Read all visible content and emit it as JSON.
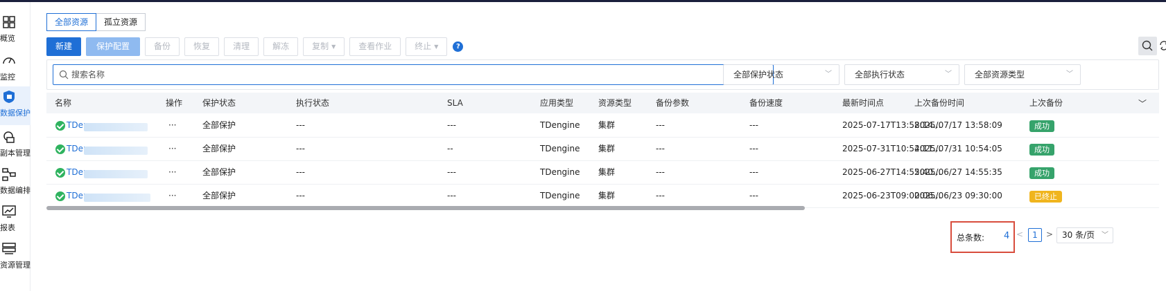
{
  "nav": {
    "items": [
      {
        "label": "概览",
        "icon": "grid-icon"
      },
      {
        "label": "监控",
        "icon": "gauge-icon"
      },
      {
        "label": "数据保护",
        "icon": "shield-icon",
        "active": true
      },
      {
        "label": "副本管理",
        "icon": "copy-icon"
      },
      {
        "label": "数据编排",
        "icon": "flow-icon"
      },
      {
        "label": "报表",
        "icon": "chart-icon"
      },
      {
        "label": "资源管理",
        "icon": "resource-icon"
      }
    ]
  },
  "tabs": [
    {
      "label": "全部资源",
      "active": true
    },
    {
      "label": "孤立资源",
      "active": false
    }
  ],
  "toolbar": {
    "new_label": "新建",
    "protect_config_label": "保护配置",
    "backup_label": "备份",
    "restore_label": "恢复",
    "clean_label": "清理",
    "unfreeze_label": "解冻",
    "copy_label": "复制",
    "view_job_label": "查看作业",
    "stop_label": "终止",
    "help_label": "?"
  },
  "filters": {
    "search_placeholder": "搜索名称",
    "protect_status": "全部保护状态",
    "exec_status": "全部执行状态",
    "resource_type": "全部资源类型"
  },
  "table": {
    "columns": [
      "名称",
      "操作",
      "保护状态",
      "执行状态",
      "SLA",
      "应用类型",
      "资源类型",
      "备份参数",
      "备份速度",
      "最新时间点",
      "上次备份时间",
      "上次备份"
    ],
    "rows": [
      {
        "name": "TDen",
        "ops": "···",
        "protect": "全部保护",
        "exec": "---",
        "sla": "---",
        "app": "TDengine",
        "rtype": "集群",
        "params": "---",
        "speed": "---",
        "latest": "2025-07-17T13:58:14...",
        "last_time": "2025/07/17 13:58:09",
        "status": "成功",
        "status_kind": "success"
      },
      {
        "name": "TDen",
        "ops": "···",
        "protect": "全部保护",
        "exec": "---",
        "sla": "--",
        "app": "TDengine",
        "rtype": "集群",
        "params": "---",
        "speed": "---",
        "latest": "2025-07-31T10:54:11...",
        "last_time": "2025/07/31 10:54:05",
        "status": "成功",
        "status_kind": "success"
      },
      {
        "name": "TDen",
        "ops": "···",
        "protect": "全部保护",
        "exec": "---",
        "sla": "---",
        "app": "TDengine",
        "rtype": "集群",
        "params": "---",
        "speed": "---",
        "latest": "2025-06-27T14:55:40...",
        "last_time": "2025/06/27 14:55:35",
        "status": "成功",
        "status_kind": "success"
      },
      {
        "name": "TDen",
        "ops": "···",
        "protect": "全部保护",
        "exec": "---",
        "sla": "---",
        "app": "TDengine",
        "rtype": "集群",
        "params": "---",
        "speed": "---",
        "latest": "2025-06-23T09:00:06...",
        "last_time": "2025/06/23 09:30:00",
        "status": "已终止",
        "status_kind": "stopped"
      }
    ]
  },
  "pagination": {
    "total_label": "总条数:",
    "total": "4",
    "prev": "<",
    "page": "1",
    "next": ">",
    "page_size": "30 条/页"
  }
}
